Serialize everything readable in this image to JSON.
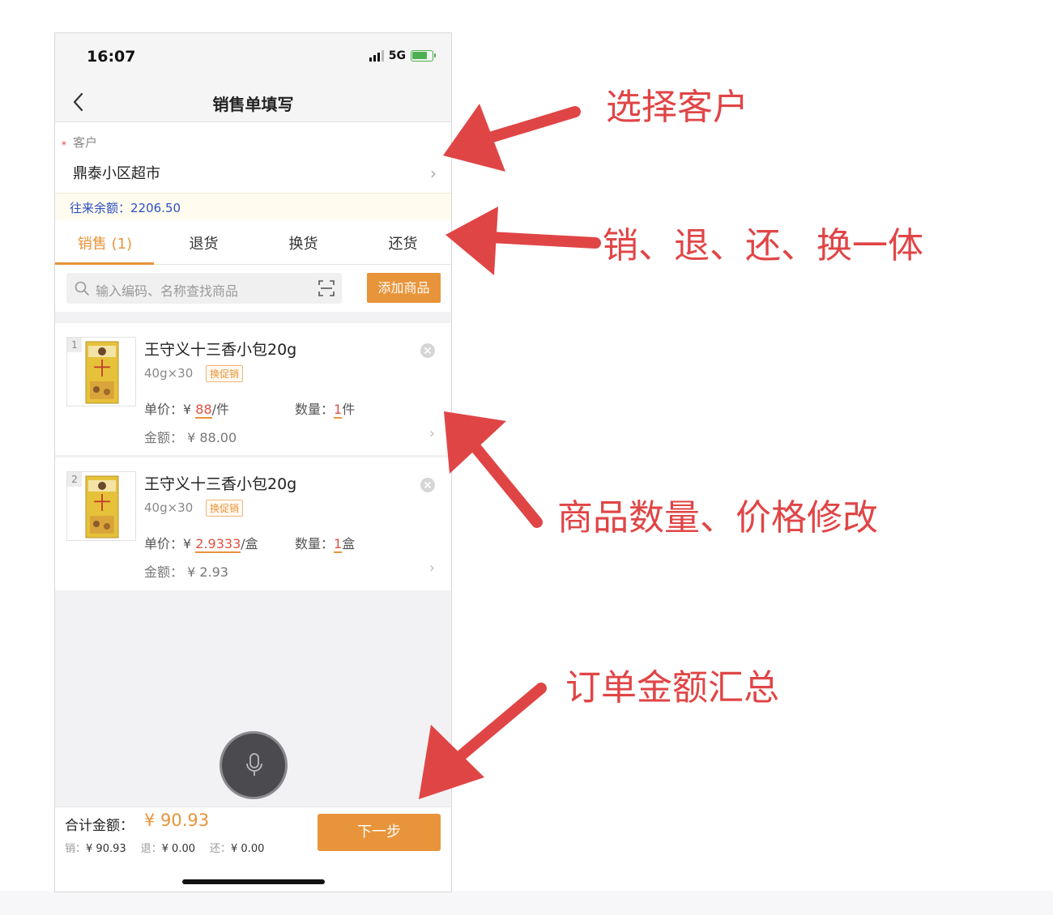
{
  "status_bar": {
    "time": "16:07",
    "network": "5G"
  },
  "nav": {
    "title": "销售单填写"
  },
  "customer": {
    "label": "客户",
    "name": "鼎泰小区超市",
    "balance": "往来余额：2206.50"
  },
  "tabs": [
    {
      "label": "销售 (1)",
      "active": true
    },
    {
      "label": "退货",
      "active": false
    },
    {
      "label": "换货",
      "active": false
    },
    {
      "label": "还货",
      "active": false
    }
  ],
  "search": {
    "placeholder": "输入编码、名称查找商品",
    "add_button": "添加商品"
  },
  "items": [
    {
      "index": "1",
      "name": "王守义十三香小包20g",
      "spec": "40g×30",
      "promo": "换促销",
      "price_label": "单价：",
      "price_prefix": "¥ ",
      "price": "88",
      "price_unit": "/件",
      "qty_label": "数量：",
      "qty": "1",
      "qty_unit": "件",
      "amount": "金额：  ¥ 88.00"
    },
    {
      "index": "2",
      "name": "王守义十三香小包20g",
      "spec": "40g×30",
      "promo": "换促销",
      "price_label": "单价：",
      "price_prefix": "¥ ",
      "price": "2.9333",
      "price_unit": "/盒",
      "qty_label": "数量：",
      "qty": "1",
      "qty_unit": "盒",
      "amount": "金额：  ¥ 2.93"
    }
  ],
  "footer": {
    "total_label": "合计金额：",
    "total": "¥ 90.93",
    "sales_label": "销：",
    "sales": "¥ 90.93",
    "returns_label": "退：",
    "returns": "¥ 0.00",
    "repay_label": "还：",
    "repay": "¥ 0.00",
    "next_button": "下一步"
  },
  "annotations": {
    "select_customer": "选择客户",
    "tabs_note": "销、退、还、换一体",
    "edit_note": "商品数量、价格修改",
    "summary_note": "订单金额汇总"
  },
  "colors": {
    "accent": "#e8943a",
    "annotation": "#e04546",
    "balance_text": "#2b4fc4"
  },
  "icons": [
    "back-chevron-icon",
    "chevron-right-icon",
    "search-icon",
    "scan-icon",
    "close-icon",
    "microphone-icon",
    "battery-icon",
    "signal-icon"
  ]
}
